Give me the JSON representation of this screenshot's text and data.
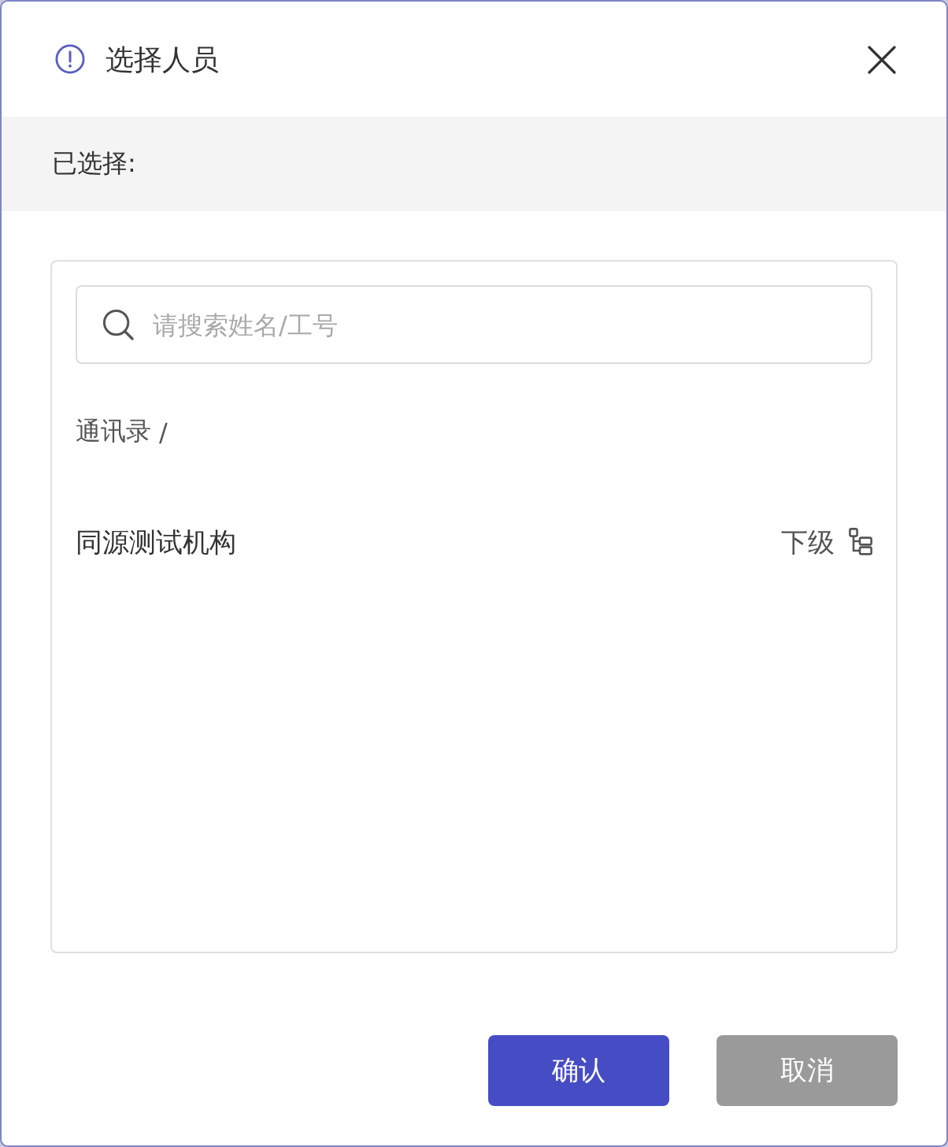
{
  "dialog": {
    "title": "选择人员",
    "selected_label": "已选择:"
  },
  "search": {
    "placeholder": "请搜索姓名/工号"
  },
  "breadcrumb": {
    "items": [
      "通讯录"
    ],
    "separator": "/"
  },
  "orgs": [
    {
      "name": "同源测试机构",
      "sub_label": "下级"
    }
  ],
  "buttons": [
    {
      "label": "确认",
      "kind": "primary"
    },
    {
      "label": "取消",
      "kind": "secondary"
    }
  ]
}
